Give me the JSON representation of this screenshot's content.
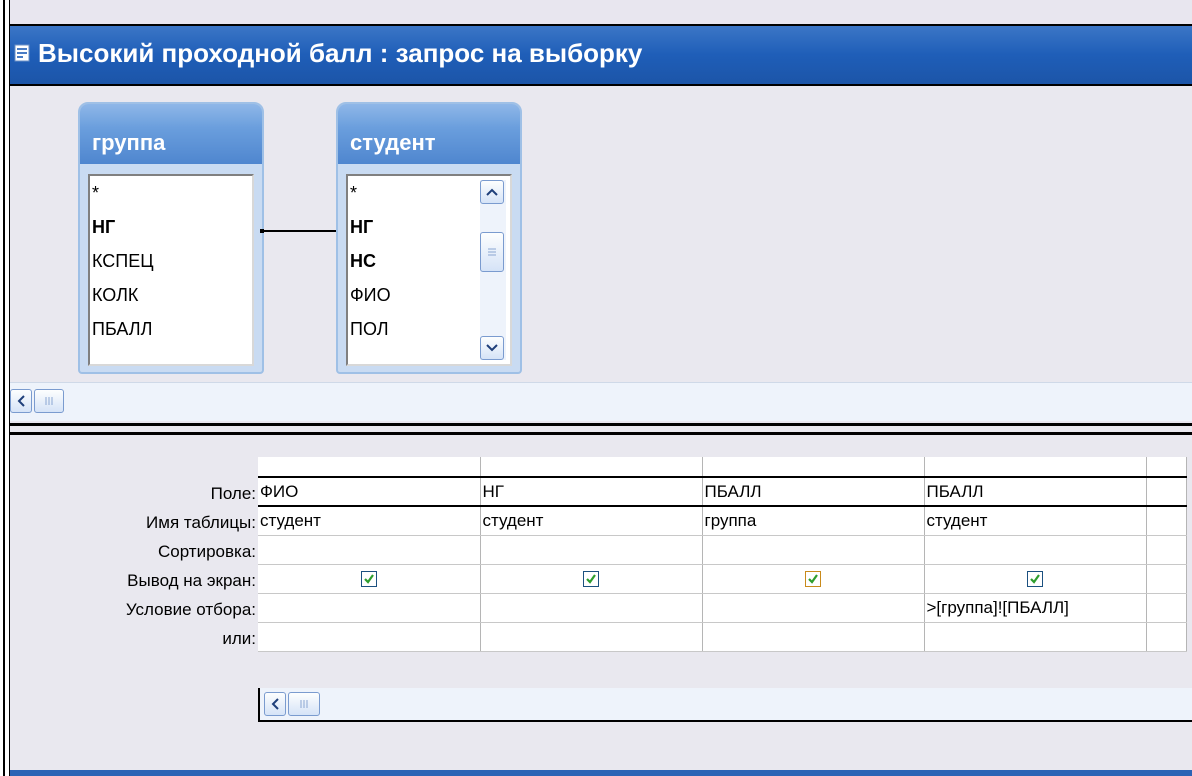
{
  "window": {
    "title": "Высокий проходной балл : запрос на выборку"
  },
  "tables": [
    {
      "name": "группа",
      "fields": [
        {
          "label": "*",
          "bold": false
        },
        {
          "label": "НГ",
          "bold": true
        },
        {
          "label": "КСПЕЦ",
          "bold": false
        },
        {
          "label": "КОЛК",
          "bold": false
        },
        {
          "label": "ПБАЛЛ",
          "bold": false
        }
      ]
    },
    {
      "name": "студент",
      "fields": [
        {
          "label": "*",
          "bold": false
        },
        {
          "label": "НГ",
          "bold": true
        },
        {
          "label": "НС",
          "bold": true
        },
        {
          "label": "ФИО",
          "bold": false
        },
        {
          "label": "ПОЛ",
          "bold": false
        }
      ]
    }
  ],
  "grid": {
    "row_labels": [
      "Поле:",
      "Имя таблицы:",
      "Сортировка:",
      "Вывод на экран:",
      "Условие отбора:",
      "или:"
    ],
    "columns": [
      {
        "field": "ФИО",
        "table": "студент",
        "sort": "",
        "show": true,
        "criteria": "",
        "or": ""
      },
      {
        "field": "НГ",
        "table": "студент",
        "sort": "",
        "show": true,
        "criteria": "",
        "or": ""
      },
      {
        "field": "ПБАЛЛ",
        "table": "группа",
        "sort": "",
        "show": true,
        "criteria": "",
        "or": ""
      },
      {
        "field": "ПБАЛЛ",
        "table": "студент",
        "sort": "",
        "show": true,
        "criteria": ">[группа]![ПБАЛЛ]",
        "or": ""
      }
    ]
  },
  "colors": {
    "titlebar": "#1f5eb8",
    "table_header": "#6a9edd",
    "check": "#2e9e2e"
  }
}
